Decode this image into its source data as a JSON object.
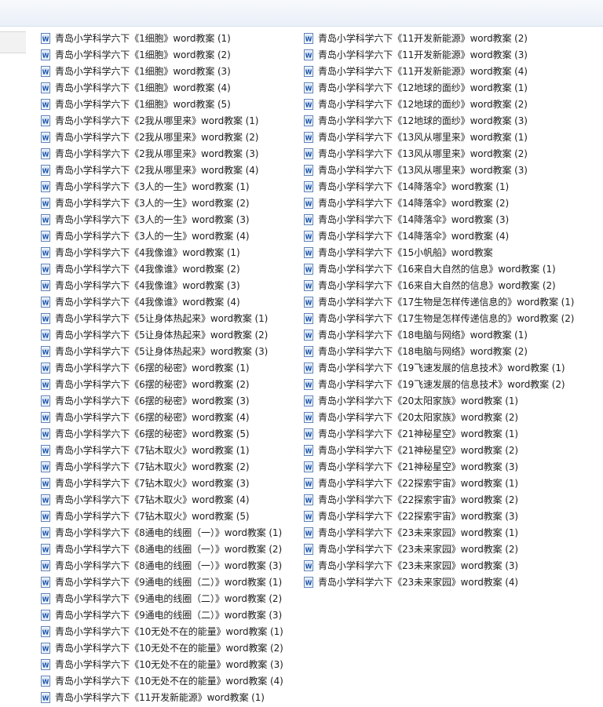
{
  "toolbar": {},
  "files": {
    "icon": "word-document-icon",
    "left": [
      "青岛小学科学六下《1细胞》word教案 (1)",
      "青岛小学科学六下《1细胞》word教案 (2)",
      "青岛小学科学六下《1细胞》word教案 (3)",
      "青岛小学科学六下《1细胞》word教案 (4)",
      "青岛小学科学六下《1细胞》word教案 (5)",
      "青岛小学科学六下《2我从哪里来》word教案 (1)",
      "青岛小学科学六下《2我从哪里来》word教案 (2)",
      "青岛小学科学六下《2我从哪里来》word教案 (3)",
      "青岛小学科学六下《2我从哪里来》word教案 (4)",
      "青岛小学科学六下《3人的一生》word教案 (1)",
      "青岛小学科学六下《3人的一生》word教案 (2)",
      "青岛小学科学六下《3人的一生》word教案 (3)",
      "青岛小学科学六下《3人的一生》word教案 (4)",
      "青岛小学科学六下《4我像谁》word教案 (1)",
      "青岛小学科学六下《4我像谁》word教案 (2)",
      "青岛小学科学六下《4我像谁》word教案 (3)",
      "青岛小学科学六下《4我像谁》word教案 (4)",
      "青岛小学科学六下《5让身体热起来》word教案 (1)",
      "青岛小学科学六下《5让身体热起来》word教案 (2)",
      "青岛小学科学六下《5让身体热起来》word教案 (3)",
      "青岛小学科学六下《6摆的秘密》word教案 (1)",
      "青岛小学科学六下《6摆的秘密》word教案 (2)",
      "青岛小学科学六下《6摆的秘密》word教案 (3)",
      "青岛小学科学六下《6摆的秘密》word教案 (4)",
      "青岛小学科学六下《6摆的秘密》word教案 (5)",
      "青岛小学科学六下《7钻木取火》word教案 (1)",
      "青岛小学科学六下《7钻木取火》word教案 (2)",
      "青岛小学科学六下《7钻木取火》word教案 (3)",
      "青岛小学科学六下《7钻木取火》word教案 (4)",
      "青岛小学科学六下《7钻木取火》word教案 (5)",
      "青岛小学科学六下《8通电的线圈（一）》word教案 (1)",
      "青岛小学科学六下《8通电的线圈（一）》word教案 (2)",
      "青岛小学科学六下《8通电的线圈（一）》word教案 (3)",
      "青岛小学科学六下《9通电的线圈（二）》word教案 (1)",
      "青岛小学科学六下《9通电的线圈（二）》word教案 (2)",
      "青岛小学科学六下《9通电的线圈（二）》word教案 (3)",
      "青岛小学科学六下《10无处不在的能量》word教案 (1)",
      "青岛小学科学六下《10无处不在的能量》word教案 (2)",
      "青岛小学科学六下《10无处不在的能量》word教案 (3)",
      "青岛小学科学六下《10无处不在的能量》word教案 (4)",
      "青岛小学科学六下《11开发新能源》word教案 (1)"
    ],
    "right": [
      "青岛小学科学六下《11开发新能源》word教案 (2)",
      "青岛小学科学六下《11开发新能源》word教案 (3)",
      "青岛小学科学六下《11开发新能源》word教案 (4)",
      "青岛小学科学六下《12地球的面纱》word教案 (1)",
      "青岛小学科学六下《12地球的面纱》word教案 (2)",
      "青岛小学科学六下《12地球的面纱》word教案 (3)",
      "青岛小学科学六下《13风从哪里来》word教案 (1)",
      "青岛小学科学六下《13风从哪里来》word教案 (2)",
      "青岛小学科学六下《13风从哪里来》word教案 (3)",
      "青岛小学科学六下《14降落伞》word教案 (1)",
      "青岛小学科学六下《14降落伞》word教案 (2)",
      "青岛小学科学六下《14降落伞》word教案 (3)",
      "青岛小学科学六下《14降落伞》word教案 (4)",
      "青岛小学科学六下《15小帆船》word教案",
      "青岛小学科学六下《16来自大自然的信息》word教案 (1)",
      "青岛小学科学六下《16来自大自然的信息》word教案 (2)",
      "青岛小学科学六下《17生物是怎样传递信息的》word教案 (1)",
      "青岛小学科学六下《17生物是怎样传递信息的》word教案 (2)",
      "青岛小学科学六下《18电脑与网络》word教案 (1)",
      "青岛小学科学六下《18电脑与网络》word教案 (2)",
      "青岛小学科学六下《19飞速发展的信息技术》word教案 (1)",
      "青岛小学科学六下《19飞速发展的信息技术》word教案 (2)",
      "青岛小学科学六下《20太阳家族》word教案 (1)",
      "青岛小学科学六下《20太阳家族》word教案 (2)",
      "青岛小学科学六下《21神秘星空》word教案 (1)",
      "青岛小学科学六下《21神秘星空》word教案 (2)",
      "青岛小学科学六下《21神秘星空》word教案 (3)",
      "青岛小学科学六下《22探索宇宙》word教案 (1)",
      "青岛小学科学六下《22探索宇宙》word教案 (2)",
      "青岛小学科学六下《22探索宇宙》word教案 (3)",
      "青岛小学科学六下《23未来家园》word教案 (1)",
      "青岛小学科学六下《23未来家园》word教案 (2)",
      "青岛小学科学六下《23未来家园》word教案 (3)",
      "青岛小学科学六下《23未来家园》word教案 (4)"
    ]
  }
}
